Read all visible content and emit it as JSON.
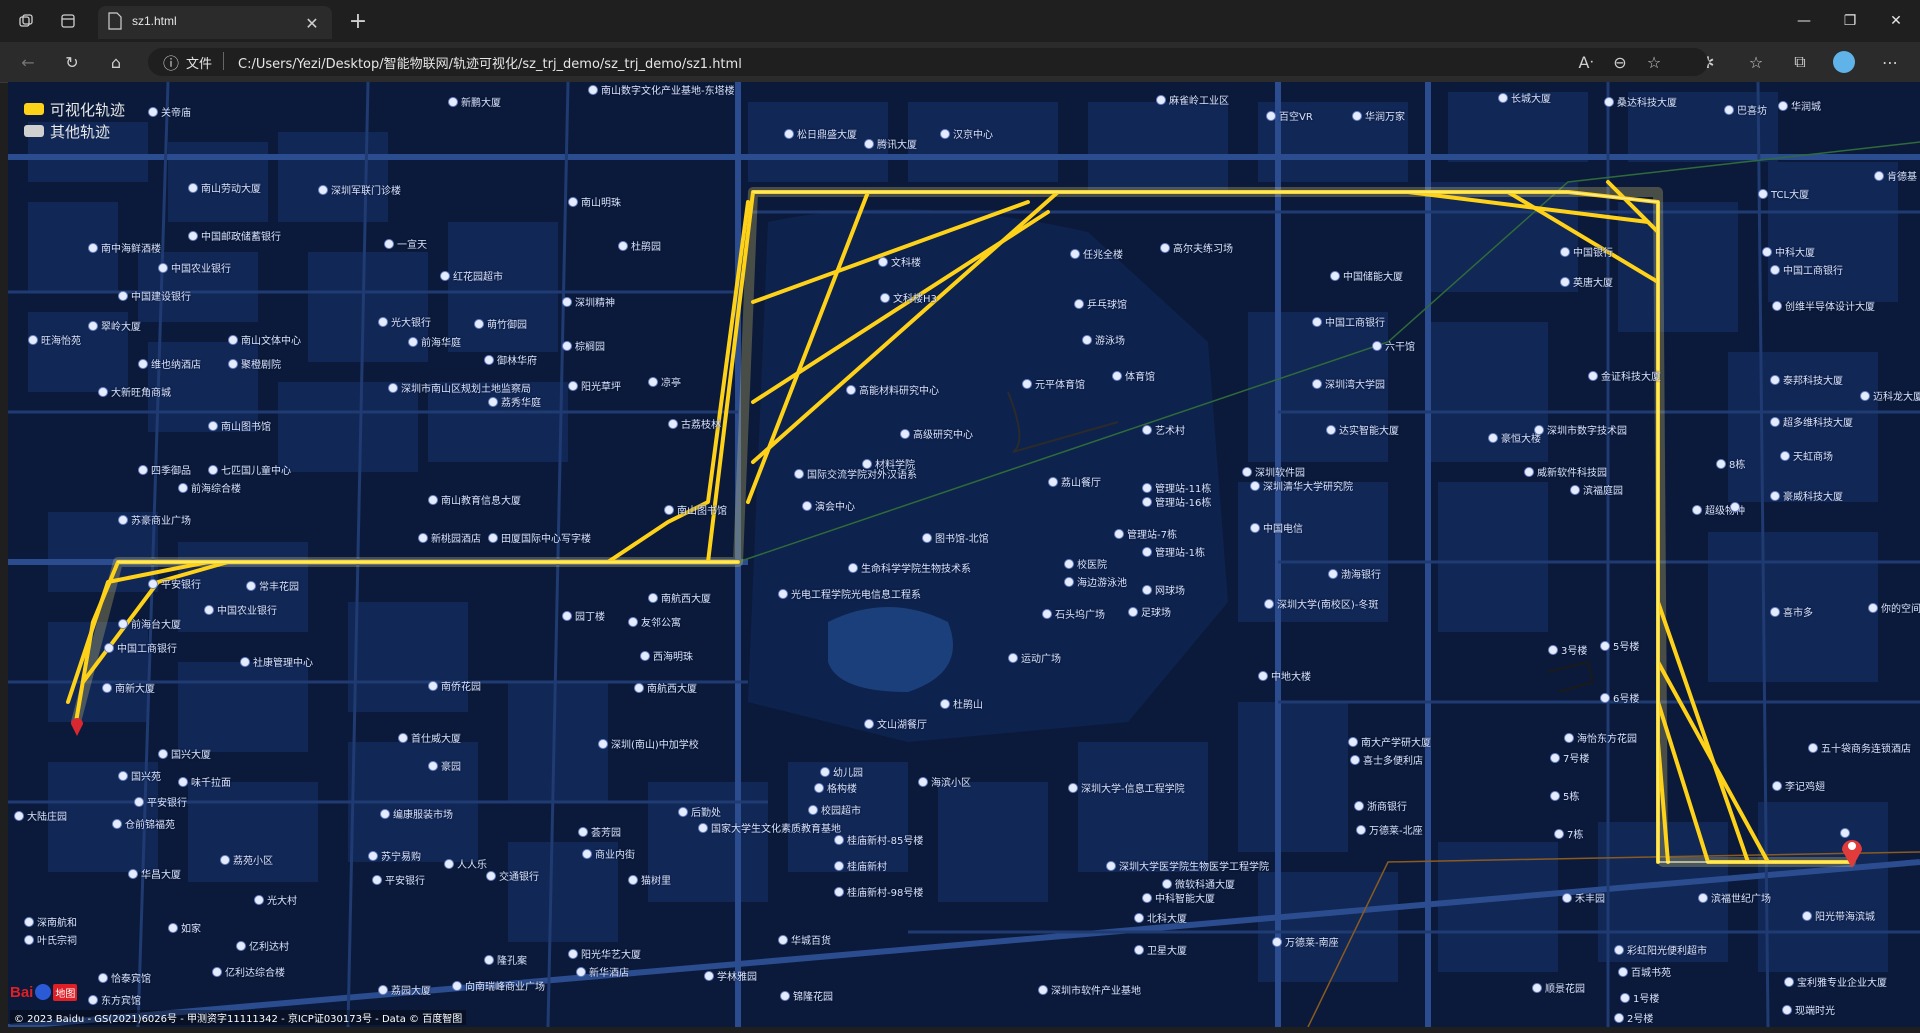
{
  "browser": {
    "tab_title": "sz1.html",
    "url_label": "文件",
    "url": "C:/Users/Yezi/Desktop/智能物联网/轨迹可视化/sz_trj_demo/sz_trj_demo/sz1.html"
  },
  "legend": {
    "items": [
      {
        "label": "可视化轨迹",
        "color": "#ffd21a"
      },
      {
        "label": "其他轨迹",
        "color": "#d0d0d0"
      }
    ]
  },
  "map": {
    "background_color": "#0b1a3a",
    "route_color": "#ffd21a",
    "poi": [
      {
        "name": "南山数字文化产业基地-东塔楼"
      },
      {
        "name": "新鹏大厦"
      },
      {
        "name": "关帝庙"
      },
      {
        "name": "南山劳动大厦"
      },
      {
        "name": "深圳军联门诊楼"
      },
      {
        "name": "中国邮政储蓄银行"
      },
      {
        "name": "南中海鲜酒楼"
      },
      {
        "name": "中国农业银行"
      },
      {
        "name": "中国建设银行"
      },
      {
        "name": "翠岭大厦"
      },
      {
        "name": "旺海怡苑"
      },
      {
        "name": "南山文体中心"
      },
      {
        "name": "维也纳酒店"
      },
      {
        "name": "聚橙剧院"
      },
      {
        "name": "大新旺角商城"
      },
      {
        "name": "南山图书馆"
      },
      {
        "name": "四季御品"
      },
      {
        "name": "七匹国儿童中心"
      },
      {
        "name": "前海综合楼"
      },
      {
        "name": "苏豪商业广场"
      },
      {
        "name": "南山教育信息大厦"
      },
      {
        "name": "新桃园酒店"
      },
      {
        "name": "田厦国际中心写字楼"
      },
      {
        "name": "平安银行"
      },
      {
        "name": "中国农业银行"
      },
      {
        "name": "常丰花园"
      },
      {
        "name": "前海台大厦"
      },
      {
        "name": "中国工商银行"
      },
      {
        "name": "社康管理中心"
      },
      {
        "name": "南航西大厦"
      },
      {
        "name": "南新大厦"
      },
      {
        "name": "国兴大厦"
      },
      {
        "name": "国兴苑"
      },
      {
        "name": "味千拉面"
      },
      {
        "name": "平安银行"
      },
      {
        "name": "大陆庄园"
      },
      {
        "name": "仓前锦福苑"
      },
      {
        "name": "华昌大厦"
      },
      {
        "name": "深南航和"
      },
      {
        "name": "叶氏宗祠"
      },
      {
        "name": "恰泰宾馆"
      },
      {
        "name": "东方宾馆"
      },
      {
        "name": "一宣天"
      },
      {
        "name": "红花园超市"
      },
      {
        "name": "光大银行"
      },
      {
        "name": "前海华庭"
      },
      {
        "name": "萌竹御园"
      },
      {
        "name": "御林华府"
      },
      {
        "name": "深圳市南山区规划土地监察局"
      },
      {
        "name": "荔秀华庭"
      },
      {
        "name": "南山明珠"
      },
      {
        "name": "杜鹃园"
      },
      {
        "name": "深圳精神"
      },
      {
        "name": "棕榈园"
      },
      {
        "name": "阳光草坪"
      },
      {
        "name": "凉亭"
      },
      {
        "name": "古荔枝林"
      },
      {
        "name": "南山图书馆"
      },
      {
        "name": "国际交流学院对外汉语系"
      },
      {
        "name": "演会中心"
      },
      {
        "name": "材料学院"
      },
      {
        "name": "图书馆-北馆"
      },
      {
        "name": "生命科学学院生物技术系"
      },
      {
        "name": "光电工程学院光电信息工程系"
      },
      {
        "name": "南航西大厦"
      },
      {
        "name": "友邻公寓"
      },
      {
        "name": "西海明珠"
      },
      {
        "name": "园丁楼"
      },
      {
        "name": "南侨花园"
      },
      {
        "name": "首仕威大厦"
      },
      {
        "name": "豪园"
      },
      {
        "name": "深圳(南山)中加学校"
      },
      {
        "name": "文山湖餐厅"
      },
      {
        "name": "幼儿园"
      },
      {
        "name": "格构楼"
      },
      {
        "name": "海滨小区"
      },
      {
        "name": "校园超市"
      },
      {
        "name": "桂庙新村-85号楼"
      },
      {
        "name": "桂庙新村"
      },
      {
        "name": "桂庙新村-98号楼"
      },
      {
        "name": "国家大学生文化素质教育基地"
      },
      {
        "name": "后勤处"
      },
      {
        "name": "荟芳园"
      },
      {
        "name": "商业内街"
      },
      {
        "name": "猫树里"
      },
      {
        "name": "编康服装市场"
      },
      {
        "name": "苏宁易购"
      },
      {
        "name": "平安银行"
      },
      {
        "name": "人人乐"
      },
      {
        "name": "交通银行"
      },
      {
        "name": "荔苑小区"
      },
      {
        "name": "光大村"
      },
      {
        "name": "如家"
      },
      {
        "name": "亿利达村"
      },
      {
        "name": "亿利达综合楼"
      },
      {
        "name": "荔园大厦"
      },
      {
        "name": "向南瑞峰商业广场"
      },
      {
        "name": "阳光华艺大厦"
      },
      {
        "name": "新华酒店"
      },
      {
        "name": "学林雅园"
      },
      {
        "name": "锦隆花园"
      },
      {
        "name": "华城百货"
      },
      {
        "name": "隆孔案"
      },
      {
        "name": "松日鼎盛大厦"
      },
      {
        "name": "腾讯大厦"
      },
      {
        "name": "汉京中心"
      },
      {
        "name": "麻雀岭工业区"
      },
      {
        "name": "百空VR"
      },
      {
        "name": "华润万家"
      },
      {
        "name": "长城大厦"
      },
      {
        "name": "桑达科技大厦"
      },
      {
        "name": "巴喜坊"
      },
      {
        "name": "华润城"
      },
      {
        "name": "肯德基"
      },
      {
        "name": "TCL大厦"
      },
      {
        "name": "中科大厦"
      },
      {
        "name": "中国工商银行"
      },
      {
        "name": "创维半导体设计大厦"
      },
      {
        "name": "泰邦科技大厦"
      },
      {
        "name": "迈科龙大厦"
      },
      {
        "name": "超多维科技大厦"
      },
      {
        "name": "天虹商场"
      },
      {
        "name": "豪威科技大厦"
      },
      {
        "name": "你的空间"
      },
      {
        "name": "喜市多"
      },
      {
        "name": "五十袋商务连锁酒店"
      },
      {
        "name": "李记鸡翅"
      },
      {
        "name": "阳光带海滨城"
      },
      {
        "name": "宝利雅专业企业大厦"
      },
      {
        "name": "现端时光"
      },
      {
        "name": "文科楼"
      },
      {
        "name": "文科楼H3"
      },
      {
        "name": "任兆全楼"
      },
      {
        "name": "高尔夫练习场"
      },
      {
        "name": "乒乓球馆"
      },
      {
        "name": "游泳场"
      },
      {
        "name": "体育馆"
      },
      {
        "name": "元平体育馆"
      },
      {
        "name": "高能材料研究中心"
      },
      {
        "name": "高级研究中心"
      },
      {
        "name": "艺术村"
      },
      {
        "name": "荔山餐厅"
      },
      {
        "name": "管理站-11栋"
      },
      {
        "name": "管理站-16栋"
      },
      {
        "name": "管理站-7栋"
      },
      {
        "name": "管理站-1栋"
      },
      {
        "name": "校医院"
      },
      {
        "name": "海边游泳池"
      },
      {
        "name": "石头坞广场"
      },
      {
        "name": "网球场"
      },
      {
        "name": "足球场"
      },
      {
        "name": "运动广场"
      },
      {
        "name": "杜鹃山"
      },
      {
        "name": "深圳大学-信息工程学院"
      },
      {
        "name": "深圳大学医学院生物医学工程学院"
      },
      {
        "name": "微软科通大厦"
      },
      {
        "name": "中科智能大厦"
      },
      {
        "name": "北科大厦"
      },
      {
        "name": "卫星大厦"
      },
      {
        "name": "深圳市软件产业基地"
      },
      {
        "name": "中国储能大厦"
      },
      {
        "name": "中国工商银行"
      },
      {
        "name": "六干馆"
      },
      {
        "name": "深圳湾大学园"
      },
      {
        "name": "达实智能大厦"
      },
      {
        "name": "深圳软件园"
      },
      {
        "name": "深圳清华大学研究院"
      },
      {
        "name": "中国电信"
      },
      {
        "name": "深圳大学(南校区)-冬斑"
      },
      {
        "name": "渤海银行"
      },
      {
        "name": "中地大楼"
      },
      {
        "name": "南大产学研大厦"
      },
      {
        "name": "喜士多便利店"
      },
      {
        "name": "浙商银行"
      },
      {
        "name": "万德莱-北座"
      },
      {
        "name": "万德莱-南座"
      },
      {
        "name": "中国银行"
      },
      {
        "name": "英唐大厦"
      },
      {
        "name": "金证科技大厦"
      },
      {
        "name": "豪恒大楼"
      },
      {
        "name": "深圳市数字技术园"
      },
      {
        "name": "威新软件科技园"
      },
      {
        "name": "滨福庭园"
      },
      {
        "name": "海怡东方花园"
      },
      {
        "name": "禾丰园"
      },
      {
        "name": "滨福世纪广场"
      },
      {
        "name": "彩虹阳光便利超市"
      },
      {
        "name": "百城书苑"
      },
      {
        "name": "顺景花园"
      },
      {
        "name": "1号楼"
      },
      {
        "name": "2号楼"
      },
      {
        "name": "3号楼"
      },
      {
        "name": "5号楼"
      },
      {
        "name": "6号楼"
      },
      {
        "name": "7号楼"
      },
      {
        "name": "5栋"
      },
      {
        "name": "7栋"
      },
      {
        "name": "8栋"
      },
      {
        "name": "超级物种"
      }
    ]
  },
  "footer": {
    "logo_text": "Bai",
    "logo_sub": "地图",
    "copyright": "© 2023 Baidu - GS(2021)6026号 - 甲测资字11111342 - 京ICP证030173号 - Data © 百度智图"
  }
}
